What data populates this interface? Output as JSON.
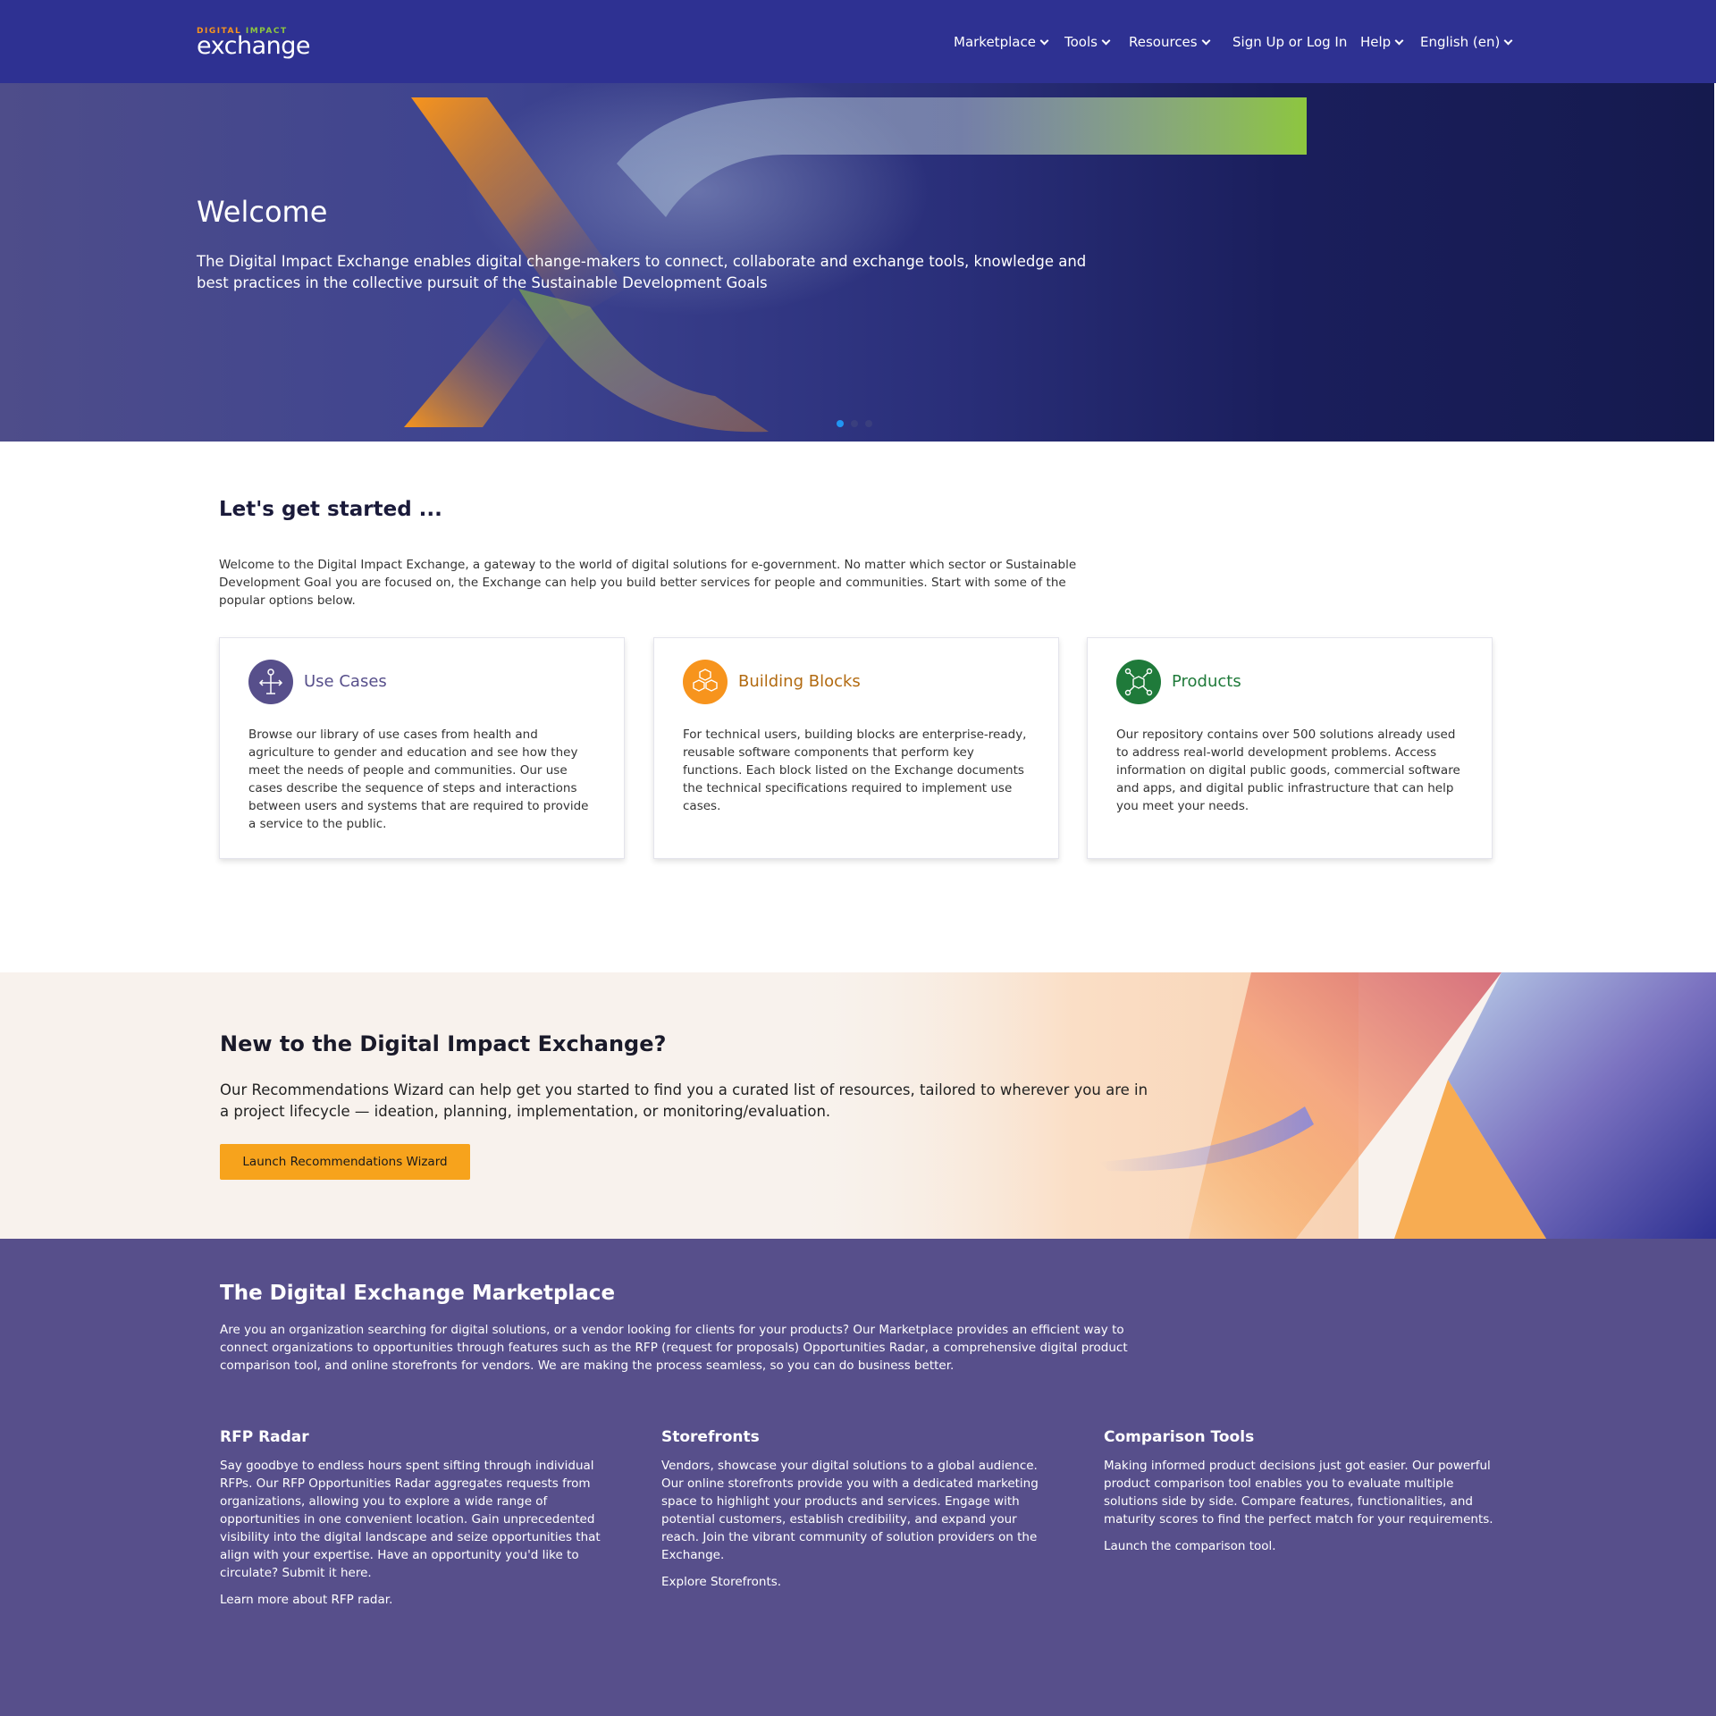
{
  "header": {
    "logo_top_a": "DIGITAL",
    "logo_top_b": "IMPACT",
    "logo_main": "exchange",
    "nav": {
      "marketplace": "Marketplace",
      "tools": "Tools",
      "resources": "Resources",
      "signup": "Sign Up or Log In",
      "help": "Help",
      "language": "English (en)"
    }
  },
  "hero": {
    "title": "Welcome",
    "text": "The Digital Impact Exchange enables digital change-makers to connect, collaborate and exchange tools, knowledge and best practices in the collective pursuit of the Sustainable Development Goals",
    "slide_count": 3,
    "active_slide": 1
  },
  "get_started": {
    "title": "Let's get started ...",
    "text": "Welcome to the Digital Impact Exchange, a gateway to the world of digital solutions for e-government. No matter which sector or Sustainable Development Goal you are focused on, the Exchange can help you build better services for people and communities. Start with some of the popular options below.",
    "cards": [
      {
        "title": "Use Cases",
        "icon": "use-cases-icon",
        "color": "#574f8b",
        "text": "Browse our library of use cases from health and agriculture to gender and education and see how they meet the needs of people and communities. Our use cases describe the sequence of steps and interactions between users and systems that are required to provide a service to the public."
      },
      {
        "title": "Building Blocks",
        "icon": "building-blocks-icon",
        "color": "#f7941d",
        "text": "For technical users, building blocks are enterprise-ready, reusable software components that perform key functions. Each block listed on the Exchange documents the technical specifications required to implement use cases."
      },
      {
        "title": "Products",
        "icon": "products-icon",
        "color": "#1f7a3a",
        "text": "Our repository contains over 500 solutions already used to address real-world development problems. Access information on digital public goods, commercial software and apps, and digital public infrastructure that can help you meet your needs."
      }
    ]
  },
  "new_to": {
    "title": "New to the Digital Impact Exchange?",
    "text": "Our Recommendations Wizard can help get you started to find you a curated list of resources, tailored to wherever you are in a project lifecycle — ideation, planning, implementation, or monitoring/evaluation.",
    "button": "Launch Recommendations Wizard"
  },
  "marketplace": {
    "title": "The Digital Exchange Marketplace",
    "text": "Are you an organization searching for digital solutions, or a vendor looking for clients for your products? Our Marketplace provides an efficient way to connect organizations to opportunities through features such as the RFP (request for proposals) Opportunities Radar, a comprehensive digital product comparison tool, and online storefronts for vendors. We are making the process seamless, so you can do business better.",
    "columns": [
      {
        "title": "RFP Radar",
        "text": "Say goodbye to endless hours spent sifting through individual RFPs. Our RFP Opportunities Radar aggregates requests from organizations, allowing you to explore a wide range of opportunities in one convenient location. Gain unprecedented visibility into the digital landscape and seize opportunities that align with your expertise. Have an opportunity you'd like to circulate? Submit it here.",
        "link": "Learn more about RFP radar."
      },
      {
        "title": "Storefronts",
        "text": "Vendors, showcase your digital solutions to a global audience. Our online storefronts provide you with a dedicated marketing space to highlight your products and services. Engage with potential customers, establish credibility, and expand your reach. Join the vibrant community of solution providers on the Exchange.",
        "link": "Explore Storefronts."
      },
      {
        "title": "Comparison Tools",
        "text": "Making informed product decisions just got easier. Our powerful product comparison tool enables you to evaluate multiple solutions side by side. Compare features, functionalities, and maturity scores to find the perfect match for your requirements.",
        "link": "Launch the comparison tool."
      }
    ]
  }
}
